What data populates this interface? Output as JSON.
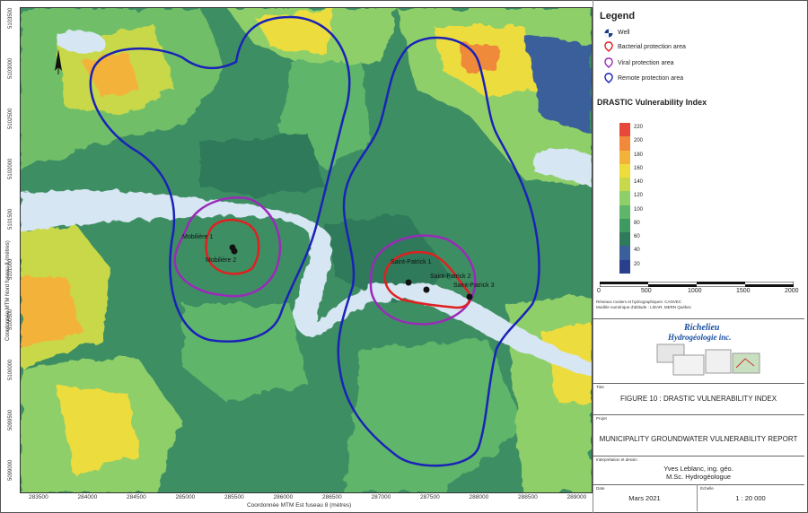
{
  "legend": {
    "title": "Legend",
    "items": [
      {
        "label": "Well",
        "icon": "well-icon"
      },
      {
        "label": "Bacterial protection area",
        "color": "#e02020"
      },
      {
        "label": "Viral protection area",
        "color": "#9a2ab8"
      },
      {
        "label": "Remote protection area",
        "color": "#1a22b8"
      }
    ]
  },
  "drastic": {
    "title": "DRASTIC Vulnerability Index",
    "labels": [
      "220",
      "200",
      "180",
      "160",
      "140",
      "120",
      "100",
      "80",
      "60",
      "40",
      "20"
    ],
    "colors": [
      "#e8483a",
      "#f08a3a",
      "#f3b33a",
      "#eddc3c",
      "#c8d84a",
      "#8fcf6a",
      "#5fb56a",
      "#3f9a62",
      "#2e7a5a",
      "#3a5f9a",
      "#2a3f8c"
    ]
  },
  "scalebar": {
    "labels": [
      "0",
      "500",
      "1000",
      "1500",
      "2000"
    ]
  },
  "sources": {
    "line1": "Réseaux routiers et hydrographiques: CANVEC",
    "line2": "Modèle numérique d'altitude : LIDAR, MERN Québec"
  },
  "logo": {
    "line1": "Richelieu",
    "line2": "Hydrogéologie inc."
  },
  "title_block": {
    "title_label": "Titre",
    "title": "FIGURE 10 : DRASTIC VULNERABILITY INDEX",
    "project_label": "Projet",
    "project": "MUNICIPALITY GROUNDWATER VULNERABILITY REPORT",
    "author_label": "Interprétation et dessin",
    "author_name": "Yves Leblanc, ing. géo.",
    "author_title": "M.Sc. Hydrogéologue",
    "date_label": "Date",
    "date": "Mars 2021",
    "scale_label": "Échelle",
    "scale": "1 : 20 000"
  },
  "map": {
    "x_ticks": [
      "283500",
      "284000",
      "284500",
      "285000",
      "285500",
      "286000",
      "286500",
      "287000",
      "287500",
      "288000",
      "288500",
      "289000"
    ],
    "y_ticks": [
      "5103500",
      "5103000",
      "5102500",
      "5102000",
      "5101500",
      "5101000",
      "5100500",
      "5100000",
      "5099500",
      "5099000"
    ],
    "x_axis_title": "Coordonnée MTM Est fuseau 8 (mètres)",
    "y_axis_title": "Coordonnée MTM Nord fuseau 8 (mètres)",
    "wells": [
      "Mobilière 1",
      "Mobilière 2",
      "Saint-Patrick 1",
      "Saint-Patrick 2",
      "Saint-Patrick 3"
    ]
  }
}
